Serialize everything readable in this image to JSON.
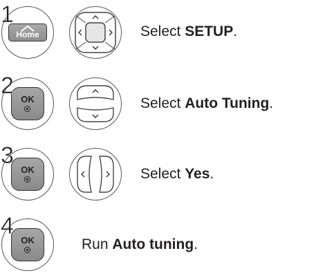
{
  "steps": [
    {
      "number": "1",
      "buttons": [
        "home-button",
        "navigation-pad"
      ],
      "home_label": "Home",
      "text_prefix": "Select ",
      "text_bold": "SETUP",
      "text_suffix": "."
    },
    {
      "number": "2",
      "buttons": [
        "ok-button",
        "up-down-buttons"
      ],
      "ok_label": "OK",
      "text_prefix": "Select ",
      "text_bold": "Auto Tuning",
      "text_suffix": "."
    },
    {
      "number": "3",
      "buttons": [
        "ok-button",
        "left-right-buttons"
      ],
      "ok_label": "OK",
      "text_prefix": "Select ",
      "text_bold": "Yes",
      "text_suffix": "."
    },
    {
      "number": "4",
      "buttons": [
        "ok-button"
      ],
      "ok_label": "OK",
      "text_prefix": "Run ",
      "text_bold": "Auto tuning",
      "text_suffix": "."
    }
  ]
}
